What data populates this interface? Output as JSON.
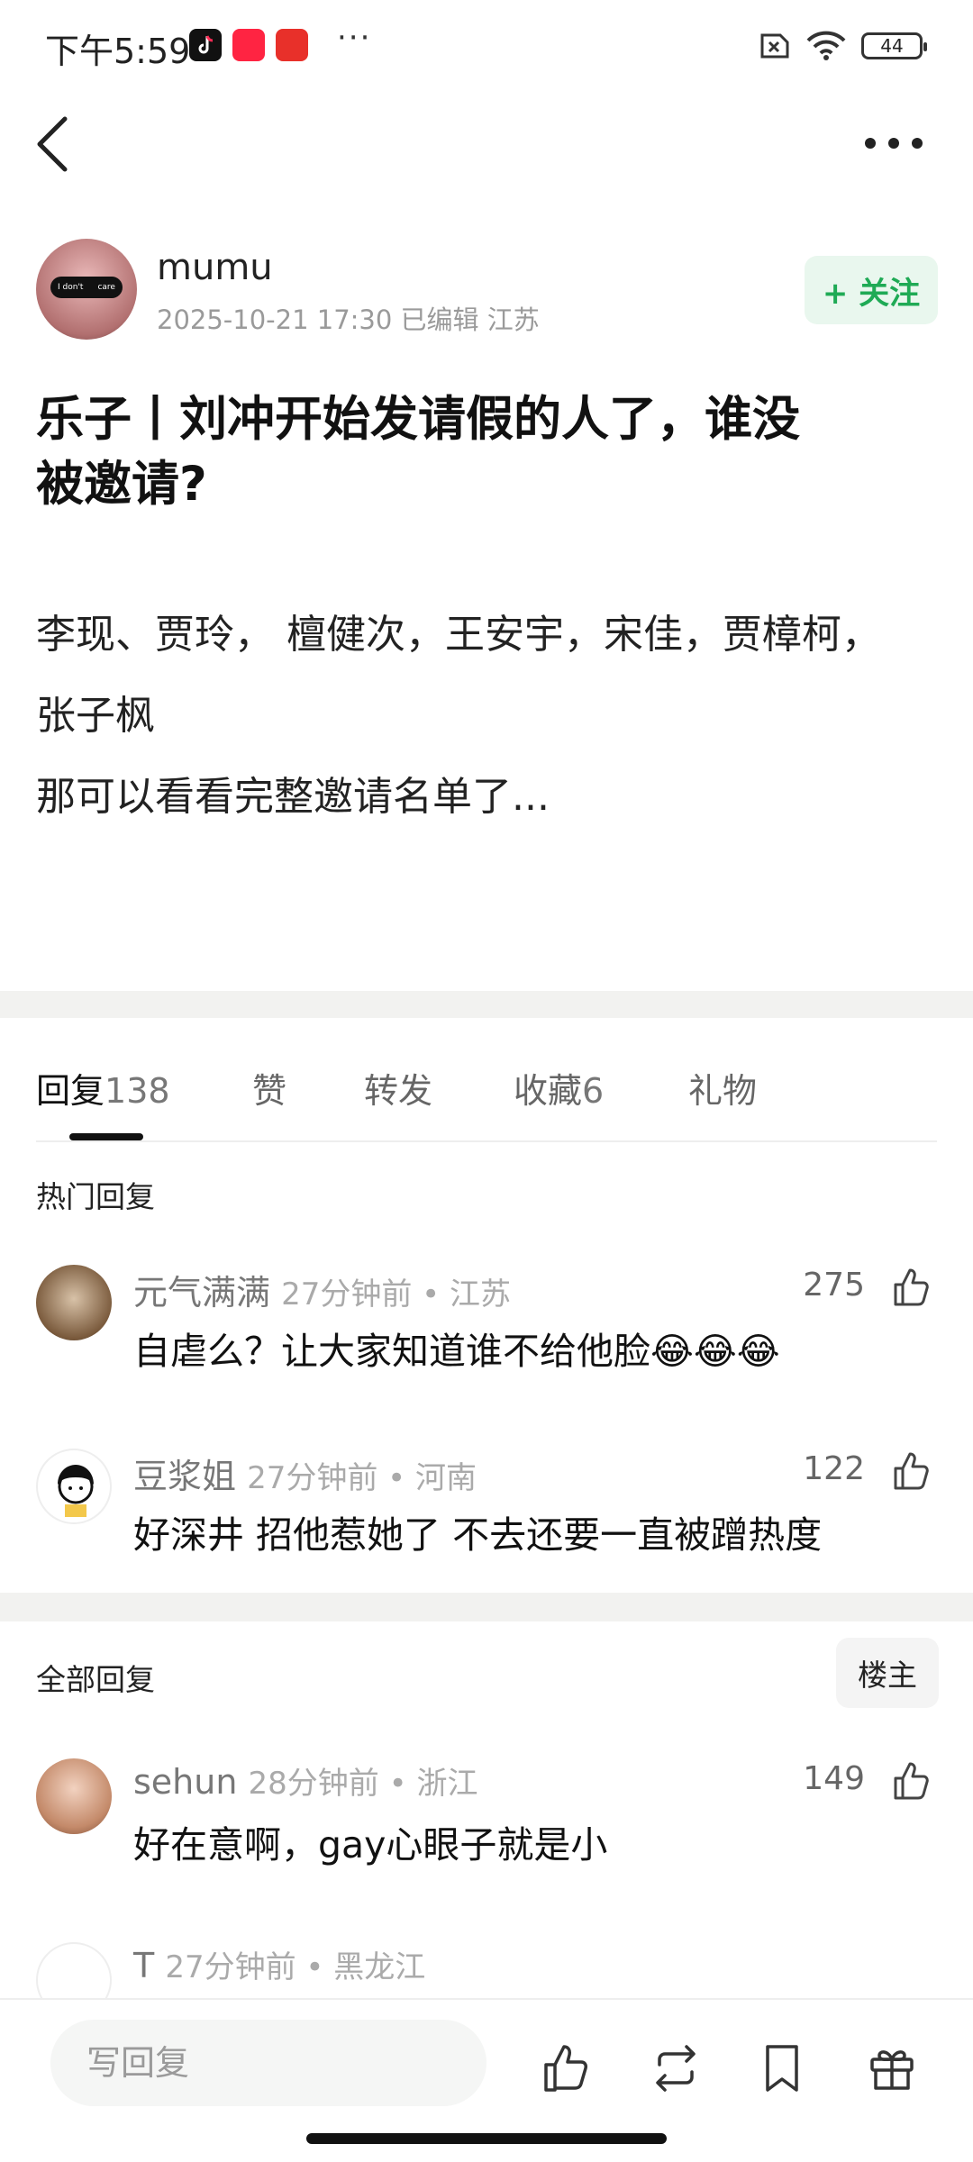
{
  "status_bar": {
    "time": "下午5:59",
    "more": "···",
    "battery": "44"
  },
  "author": {
    "name": "mumu",
    "meta": "2025-10-21 17:30  已编辑  江苏",
    "follow_label": "+ 关注",
    "avatar_text_1": "I don't",
    "avatar_text_2": "care"
  },
  "post": {
    "title_line1": "乐子丨刘冲开始发请假的人了，谁没",
    "title_line2": "被邀请?",
    "body_lines": [
      "李现、贾玲， 檀健次，王安宇，宋佳，贾樟柯，",
      "张子枫",
      "那可以看看完整邀请名单了..."
    ]
  },
  "tabs": {
    "reply_label": "回复",
    "reply_count": "138",
    "like_label": "赞",
    "forward_label": "转发",
    "collect_label": "收藏",
    "collect_count": "6",
    "gift_label": "礼物"
  },
  "hot_section": {
    "title": "热门回复",
    "comments": [
      {
        "name": "元气满满",
        "meta": "27分钟前 • 江苏",
        "text": "自虐么？让大家知道谁不给他脸😂😂😂",
        "likes": "275"
      },
      {
        "name": "豆浆姐",
        "meta": "27分钟前 • 河南",
        "text": "好深井  招他惹她了 不去还要一直被蹭热度",
        "likes": "122"
      }
    ]
  },
  "all_section": {
    "title": "全部回复",
    "op_button": "楼主",
    "comments": [
      {
        "name": "sehun",
        "meta": "28分钟前 • 浙江",
        "text": "好在意啊，gay心眼子就是小",
        "likes": "149"
      },
      {
        "name": "T",
        "meta": "27分钟前 • 黑龙江",
        "text": "",
        "likes": ""
      }
    ]
  },
  "bottom_bar": {
    "reply_placeholder": "写回复"
  },
  "colors": {
    "accent_green": "#1faa55",
    "follow_bg": "#e9f7ee",
    "separator": "#f2f2f0"
  }
}
